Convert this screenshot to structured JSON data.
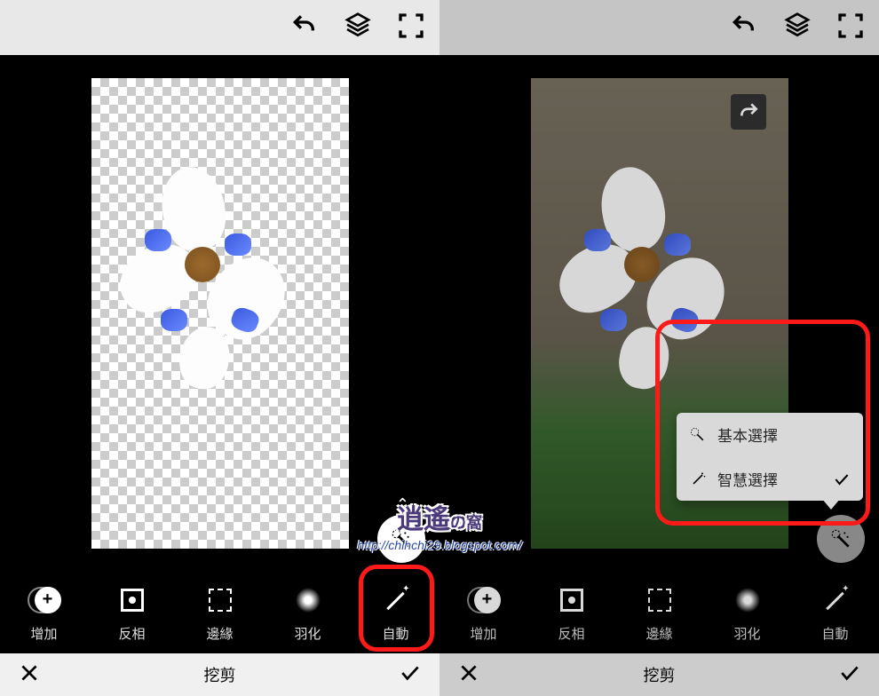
{
  "topbar": {
    "undo": "undo",
    "layers": "layers",
    "fullscreen": "fullscreen"
  },
  "toolbar": {
    "add": "增加",
    "invert": "反相",
    "edge": "邊緣",
    "feather": "羽化",
    "auto": "自動"
  },
  "bottombar": {
    "title": "挖剪",
    "cancel": "✕",
    "confirm": "✓"
  },
  "popup": {
    "basic": "基本選擇",
    "smart": "智慧選擇"
  },
  "watermark": {
    "line1": "逍遙",
    "line1_small": "の窩",
    "line2": "http://chihchi29.blogspot.com/"
  }
}
